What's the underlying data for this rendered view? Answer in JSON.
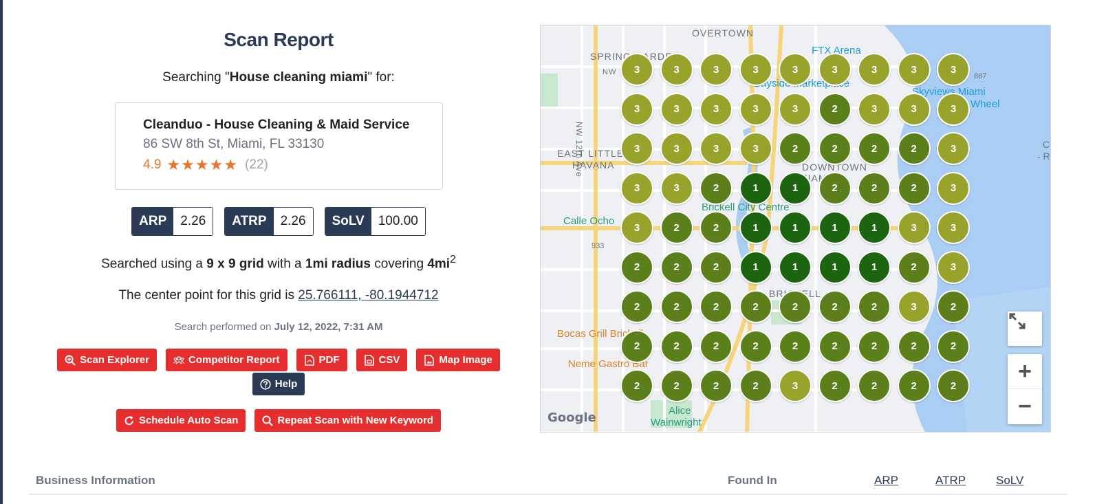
{
  "report": {
    "title": "Scan Report",
    "search_prefix": "Searching \"",
    "keyword": "House cleaning miami",
    "search_suffix": "\" for:",
    "business": {
      "name": "Cleanduo - House Cleaning & Maid Service",
      "address": "86 SW 8th St, Miami, FL 33130",
      "rating": "4.9",
      "stars": "★★★★★",
      "reviews": "(22)"
    },
    "metrics": [
      {
        "label": "ARP",
        "value": "2.26"
      },
      {
        "label": "ATRP",
        "value": "2.26"
      },
      {
        "label": "SoLV",
        "value": "100.00"
      }
    ],
    "grid_text": {
      "p1": "Searched using a ",
      "grid": "9 x 9 grid",
      "p2": " with a ",
      "radius": "1mi radius",
      "p3": " covering ",
      "area": "4mi",
      "area_sup": "2"
    },
    "center_text": "The center point for this grid is ",
    "center_coords": "25.766111, -80.1944712",
    "performed_prefix": "Search performed on ",
    "performed_date": "July 12, 2022, 7:31 AM",
    "buttons": {
      "scan_explorer": "Scan Explorer",
      "competitor_report": "Competitor Report",
      "pdf": "PDF",
      "csv": "CSV",
      "map_image": "Map Image",
      "help": "Help",
      "schedule": "Schedule Auto Scan",
      "repeat": "Repeat Scan with New Keyword"
    }
  },
  "map": {
    "labels": {
      "overtown": "OVERTOWN",
      "spring_garden": "SPRING GARDEN",
      "nw": "NW",
      "nw12": "NW 12th Ave",
      "east_little": "EAST LITTLE",
      "havana": "HAVANA",
      "downtown": "DOWNTOWN",
      "miami": "MIAMI",
      "brickell": "BRICKELL",
      "brickell_city": "Brickell City Centre",
      "calle_ocho": "Calle Ocho",
      "bocas": "Bocas Grill Brickell",
      "neme": "Neme Gastro Bar",
      "alice": "Alice",
      "wainwright": "Wainwright",
      "fxt": "FTX Arena",
      "skyviews": "Skyviews Miami",
      "wheel": "Wheel",
      "bayside": "Bayside Marketplace",
      "road933": "933",
      "road887": "887",
      "c1": "C",
      "c2": "- R",
      "google": "Google"
    },
    "grid": [
      [
        3,
        3,
        3,
        3,
        3,
        3,
        3,
        3,
        3
      ],
      [
        3,
        3,
        3,
        3,
        3,
        2,
        3,
        3,
        3
      ],
      [
        3,
        3,
        3,
        3,
        2,
        2,
        2,
        2,
        3
      ],
      [
        3,
        3,
        2,
        1,
        1,
        2,
        2,
        2,
        3
      ],
      [
        3,
        2,
        2,
        1,
        1,
        1,
        1,
        3,
        3
      ],
      [
        2,
        2,
        2,
        1,
        1,
        1,
        1,
        2,
        3
      ],
      [
        2,
        2,
        2,
        2,
        2,
        2,
        2,
        3,
        2
      ],
      [
        2,
        2,
        2,
        2,
        2,
        2,
        2,
        2,
        2
      ],
      [
        2,
        2,
        2,
        2,
        3,
        2,
        2,
        2,
        2
      ]
    ],
    "zoom_in": "+",
    "zoom_out": "−"
  },
  "table_header": {
    "business_info": "Business Information",
    "found_in": "Found In",
    "arp": "ARP",
    "atrp": "ATRP",
    "solv": "SoLV"
  }
}
